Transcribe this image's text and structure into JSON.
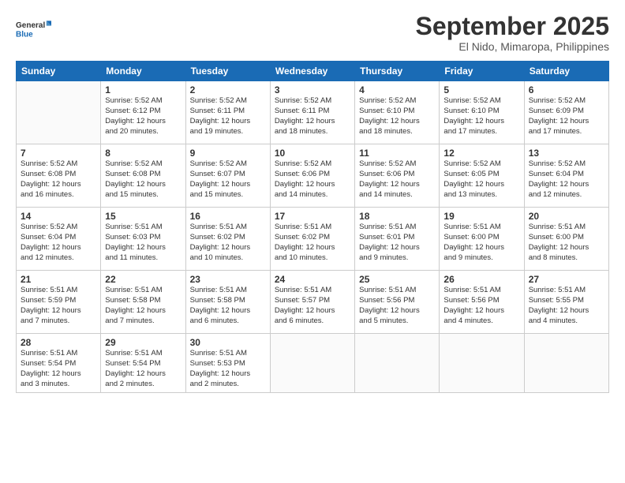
{
  "header": {
    "logo_line1": "General",
    "logo_line2": "Blue",
    "month_title": "September 2025",
    "location": "El Nido, Mimaropa, Philippines"
  },
  "days_of_week": [
    "Sunday",
    "Monday",
    "Tuesday",
    "Wednesday",
    "Thursday",
    "Friday",
    "Saturday"
  ],
  "weeks": [
    [
      {
        "day": "",
        "info": ""
      },
      {
        "day": "1",
        "info": "Sunrise: 5:52 AM\nSunset: 6:12 PM\nDaylight: 12 hours\nand 20 minutes."
      },
      {
        "day": "2",
        "info": "Sunrise: 5:52 AM\nSunset: 6:11 PM\nDaylight: 12 hours\nand 19 minutes."
      },
      {
        "day": "3",
        "info": "Sunrise: 5:52 AM\nSunset: 6:11 PM\nDaylight: 12 hours\nand 18 minutes."
      },
      {
        "day": "4",
        "info": "Sunrise: 5:52 AM\nSunset: 6:10 PM\nDaylight: 12 hours\nand 18 minutes."
      },
      {
        "day": "5",
        "info": "Sunrise: 5:52 AM\nSunset: 6:10 PM\nDaylight: 12 hours\nand 17 minutes."
      },
      {
        "day": "6",
        "info": "Sunrise: 5:52 AM\nSunset: 6:09 PM\nDaylight: 12 hours\nand 17 minutes."
      }
    ],
    [
      {
        "day": "7",
        "info": "Sunrise: 5:52 AM\nSunset: 6:08 PM\nDaylight: 12 hours\nand 16 minutes."
      },
      {
        "day": "8",
        "info": "Sunrise: 5:52 AM\nSunset: 6:08 PM\nDaylight: 12 hours\nand 15 minutes."
      },
      {
        "day": "9",
        "info": "Sunrise: 5:52 AM\nSunset: 6:07 PM\nDaylight: 12 hours\nand 15 minutes."
      },
      {
        "day": "10",
        "info": "Sunrise: 5:52 AM\nSunset: 6:06 PM\nDaylight: 12 hours\nand 14 minutes."
      },
      {
        "day": "11",
        "info": "Sunrise: 5:52 AM\nSunset: 6:06 PM\nDaylight: 12 hours\nand 14 minutes."
      },
      {
        "day": "12",
        "info": "Sunrise: 5:52 AM\nSunset: 6:05 PM\nDaylight: 12 hours\nand 13 minutes."
      },
      {
        "day": "13",
        "info": "Sunrise: 5:52 AM\nSunset: 6:04 PM\nDaylight: 12 hours\nand 12 minutes."
      }
    ],
    [
      {
        "day": "14",
        "info": "Sunrise: 5:52 AM\nSunset: 6:04 PM\nDaylight: 12 hours\nand 12 minutes."
      },
      {
        "day": "15",
        "info": "Sunrise: 5:51 AM\nSunset: 6:03 PM\nDaylight: 12 hours\nand 11 minutes."
      },
      {
        "day": "16",
        "info": "Sunrise: 5:51 AM\nSunset: 6:02 PM\nDaylight: 12 hours\nand 10 minutes."
      },
      {
        "day": "17",
        "info": "Sunrise: 5:51 AM\nSunset: 6:02 PM\nDaylight: 12 hours\nand 10 minutes."
      },
      {
        "day": "18",
        "info": "Sunrise: 5:51 AM\nSunset: 6:01 PM\nDaylight: 12 hours\nand 9 minutes."
      },
      {
        "day": "19",
        "info": "Sunrise: 5:51 AM\nSunset: 6:00 PM\nDaylight: 12 hours\nand 9 minutes."
      },
      {
        "day": "20",
        "info": "Sunrise: 5:51 AM\nSunset: 6:00 PM\nDaylight: 12 hours\nand 8 minutes."
      }
    ],
    [
      {
        "day": "21",
        "info": "Sunrise: 5:51 AM\nSunset: 5:59 PM\nDaylight: 12 hours\nand 7 minutes."
      },
      {
        "day": "22",
        "info": "Sunrise: 5:51 AM\nSunset: 5:58 PM\nDaylight: 12 hours\nand 7 minutes."
      },
      {
        "day": "23",
        "info": "Sunrise: 5:51 AM\nSunset: 5:58 PM\nDaylight: 12 hours\nand 6 minutes."
      },
      {
        "day": "24",
        "info": "Sunrise: 5:51 AM\nSunset: 5:57 PM\nDaylight: 12 hours\nand 6 minutes."
      },
      {
        "day": "25",
        "info": "Sunrise: 5:51 AM\nSunset: 5:56 PM\nDaylight: 12 hours\nand 5 minutes."
      },
      {
        "day": "26",
        "info": "Sunrise: 5:51 AM\nSunset: 5:56 PM\nDaylight: 12 hours\nand 4 minutes."
      },
      {
        "day": "27",
        "info": "Sunrise: 5:51 AM\nSunset: 5:55 PM\nDaylight: 12 hours\nand 4 minutes."
      }
    ],
    [
      {
        "day": "28",
        "info": "Sunrise: 5:51 AM\nSunset: 5:54 PM\nDaylight: 12 hours\nand 3 minutes."
      },
      {
        "day": "29",
        "info": "Sunrise: 5:51 AM\nSunset: 5:54 PM\nDaylight: 12 hours\nand 2 minutes."
      },
      {
        "day": "30",
        "info": "Sunrise: 5:51 AM\nSunset: 5:53 PM\nDaylight: 12 hours\nand 2 minutes."
      },
      {
        "day": "",
        "info": ""
      },
      {
        "day": "",
        "info": ""
      },
      {
        "day": "",
        "info": ""
      },
      {
        "day": "",
        "info": ""
      }
    ]
  ]
}
